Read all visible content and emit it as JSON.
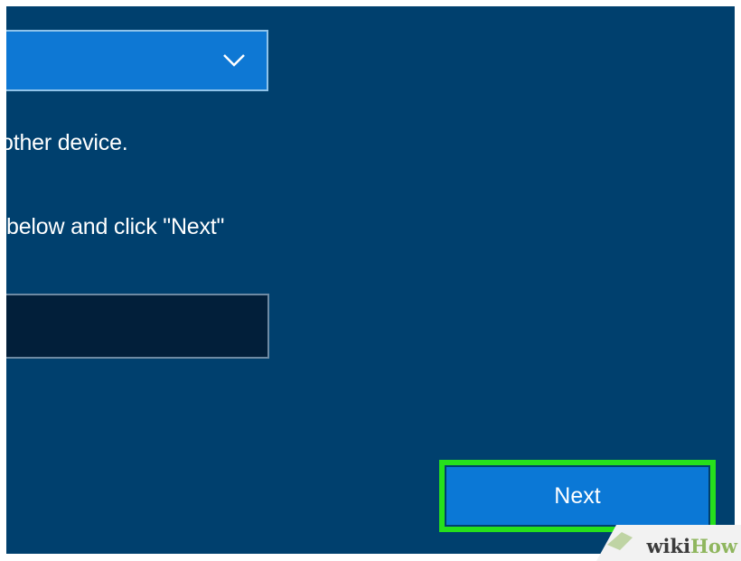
{
  "screen": {
    "background": "#00406e",
    "dropdown": {
      "selected_value": "",
      "icon": "chevron-down-icon"
    },
    "instructions": {
      "line1": "other device.",
      "line2": "below and click \"Next\""
    },
    "code_input": {
      "value": "",
      "placeholder": ""
    },
    "next_button": {
      "label": "Next",
      "highlight_color": "#26e01c",
      "color": "#0b78d6"
    }
  },
  "watermark": {
    "wiki": "wiki",
    "how": "How"
  }
}
